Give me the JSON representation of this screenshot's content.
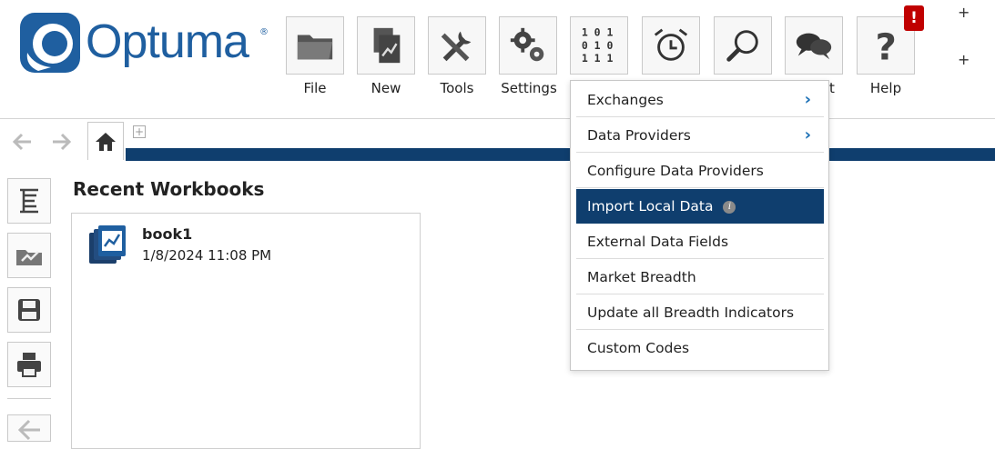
{
  "app": {
    "brand": "Optuma",
    "brand_color": "#1f5fa0"
  },
  "toolbar": {
    "buttons": [
      {
        "icon": "folder-icon",
        "label": "File"
      },
      {
        "icon": "new-document-icon",
        "label": "New"
      },
      {
        "icon": "tools-icon",
        "label": "Tools"
      },
      {
        "icon": "gears-icon",
        "label": "Settings"
      },
      {
        "icon": "binary-data-icon",
        "label": ""
      },
      {
        "icon": "alarm-clock-icon",
        "label": ""
      },
      {
        "icon": "search-icon",
        "label": ""
      },
      {
        "icon": "chat-bubbles-icon",
        "label": "t"
      },
      {
        "icon": "help-icon",
        "label": "Help"
      }
    ],
    "alert_badge": "!",
    "plus_top": "+",
    "plus_bottom": "+"
  },
  "nav": {
    "add_tab": "+",
    "accent": "#0f3e6e"
  },
  "recent_workbooks": {
    "title": "Recent Workbooks",
    "items": [
      {
        "name": "book1",
        "date": "1/8/2024 11:08 PM"
      }
    ]
  },
  "data_menu": {
    "items": [
      {
        "label": "Exchanges",
        "submenu": true
      },
      {
        "label": "Data Providers",
        "submenu": true
      },
      {
        "label": "Configure Data Providers",
        "submenu": false
      },
      {
        "label": "Import Local Data",
        "submenu": false,
        "selected": true,
        "info": "i"
      },
      {
        "label": "External Data Fields",
        "submenu": false
      },
      {
        "label": "Market Breadth",
        "submenu": false
      },
      {
        "label": "Update all Breadth Indicators",
        "submenu": false
      },
      {
        "label": "Custom Codes",
        "submenu": false
      }
    ],
    "chevron": "›",
    "selected_color": "#0f3e6e"
  }
}
